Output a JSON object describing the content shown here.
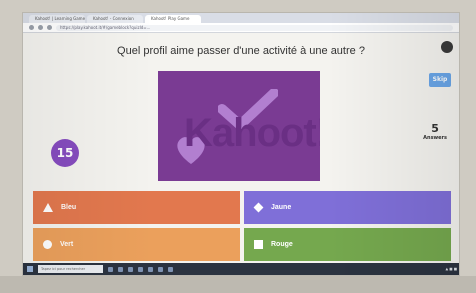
{
  "browser": {
    "tabs": [
      "Kahoot! | Learning Games",
      "Kahoot! - Connexion",
      "Kahoot! Play Game"
    ],
    "url": "https://play.kahoot.it/#/gameblock?quizId=..."
  },
  "quiz": {
    "question": "Quel profil aime passer d'une activité à une autre ?",
    "timer": "15",
    "skip_label": "Skip",
    "answers_count": "5",
    "answers_label": "Answers",
    "media_text": "Kahoot!",
    "answers": [
      {
        "label": "Bleu",
        "color": "#e2784e",
        "shape": "triangle-icon"
      },
      {
        "label": "Jaune",
        "color": "#7f6fd8",
        "shape": "diamond-icon"
      },
      {
        "label": "Vert",
        "color": "#eba05c",
        "shape": "circle-icon"
      },
      {
        "label": "Rouge",
        "color": "#75a84e",
        "shape": "square-icon"
      }
    ]
  },
  "taskbar": {
    "search_placeholder": "Tapez ici pour rechercher"
  }
}
